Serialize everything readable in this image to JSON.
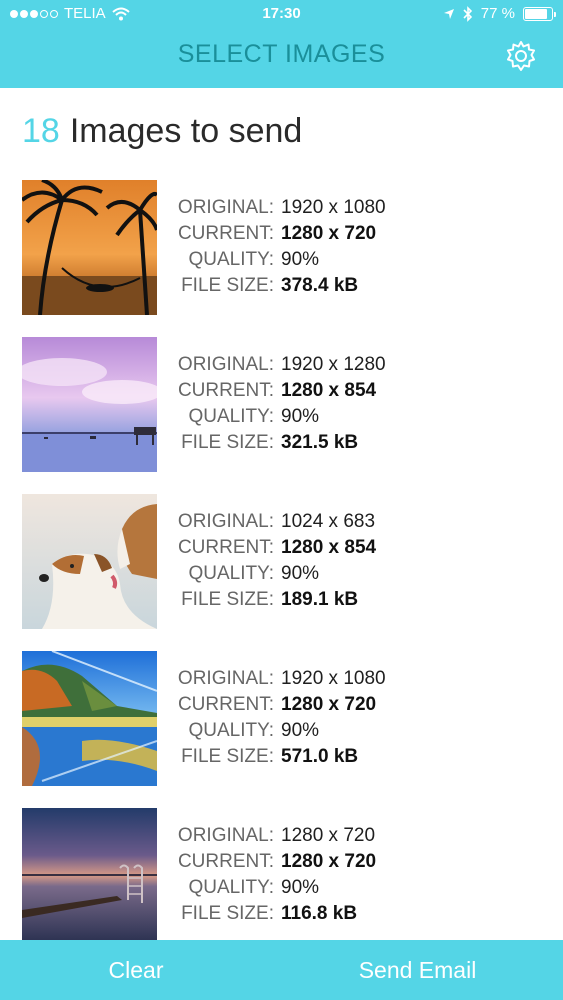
{
  "status_bar": {
    "carrier": "TELIA",
    "time": "17:30",
    "battery_text": "77 %",
    "battery_level": 0.77
  },
  "nav": {
    "title": "SELECT IMAGES",
    "settings_icon": "gear-icon"
  },
  "heading": {
    "count": "18",
    "text": "Images to send"
  },
  "labels": {
    "original": "ORIGINAL:",
    "current": "CURRENT:",
    "quality": "QUALITY:",
    "file_size": "FILE SIZE:"
  },
  "images": [
    {
      "thumbnail": "sunset-hammock-palms",
      "original": "1920 x 1080",
      "current": "1280 x 720",
      "quality": "90%",
      "file_size": "378.4 kB"
    },
    {
      "thumbnail": "purple-sky-lake-pier",
      "original": "1920 x 1280",
      "current": "1280 x 854",
      "quality": "90%",
      "file_size": "321.5 kB"
    },
    {
      "thumbnail": "two-dogs-nuzzling",
      "original": "1024 x 683",
      "current": "1280 x 854",
      "quality": "90%",
      "file_size": "189.1 kB"
    },
    {
      "thumbnail": "mountain-lake-reflection",
      "original": "1920 x 1080",
      "current": "1280 x 720",
      "quality": "90%",
      "file_size": "571.0 kB"
    },
    {
      "thumbnail": "dusk-lake-ladder",
      "original": "1280 x 720",
      "current": "1280 x 720",
      "quality": "90%",
      "file_size": "116.8 kB"
    }
  ],
  "bottom_bar": {
    "clear_label": "Clear",
    "send_label": "Send Email"
  },
  "colors": {
    "accent": "#54d5e6",
    "title_text": "#1a8f9a"
  }
}
